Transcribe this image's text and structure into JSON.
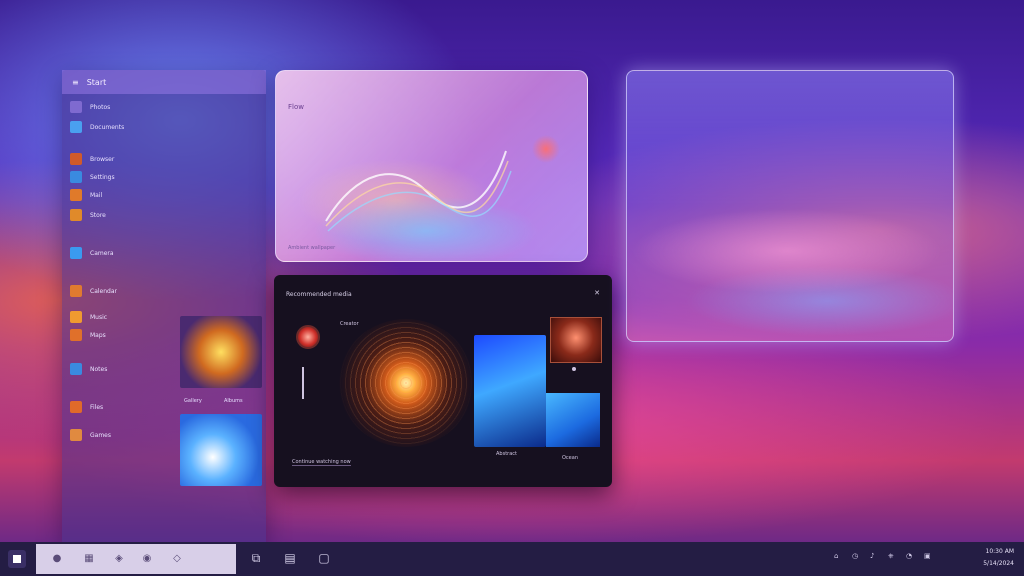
{
  "app_panel": {
    "header_title": "Start",
    "items": [
      {
        "label": "Photos",
        "color": "#7f6ad0"
      },
      {
        "label": "Documents",
        "color": "#4aa0f0"
      },
      {
        "label": "Browser",
        "color": "#d05a2a"
      },
      {
        "label": "Settings",
        "color": "#3a8ae0"
      },
      {
        "label": "Mail",
        "color": "#e07a2a"
      },
      {
        "label": "Store",
        "color": "#e08a2a"
      },
      {
        "label": "Camera",
        "color": "#3a9af0"
      },
      {
        "label": "Calendar",
        "color": "#e07a30"
      },
      {
        "label": "Music",
        "color": "#f09a30"
      },
      {
        "label": "Maps",
        "color": "#e0702a"
      },
      {
        "label": "Notes",
        "color": "#3a8ae0"
      },
      {
        "label": "Files",
        "color": "#e06a2a"
      },
      {
        "label": "Games",
        "color": "#e08a40"
      }
    ],
    "thumb_captions": [
      "Gallery",
      "Albums"
    ]
  },
  "glass_card": {
    "title": "Flow",
    "footer": "Ambient wallpaper"
  },
  "media_panel": {
    "title": "Recommended media",
    "close": "✕",
    "avatar_label": "Creator",
    "caption": "Continue watching now",
    "caption_a": "Abstract",
    "caption_c": "Ocean"
  },
  "taskbar": {
    "pinned": [
      "●",
      "▦",
      "◈",
      "◉",
      "◇"
    ],
    "icons": [
      "⧉",
      "▤",
      "▢"
    ],
    "tray": [
      "⌂",
      "◷",
      "♪",
      "⎈",
      "◔",
      "▣"
    ],
    "time": "10:30 AM",
    "date": "5/14/2024"
  }
}
